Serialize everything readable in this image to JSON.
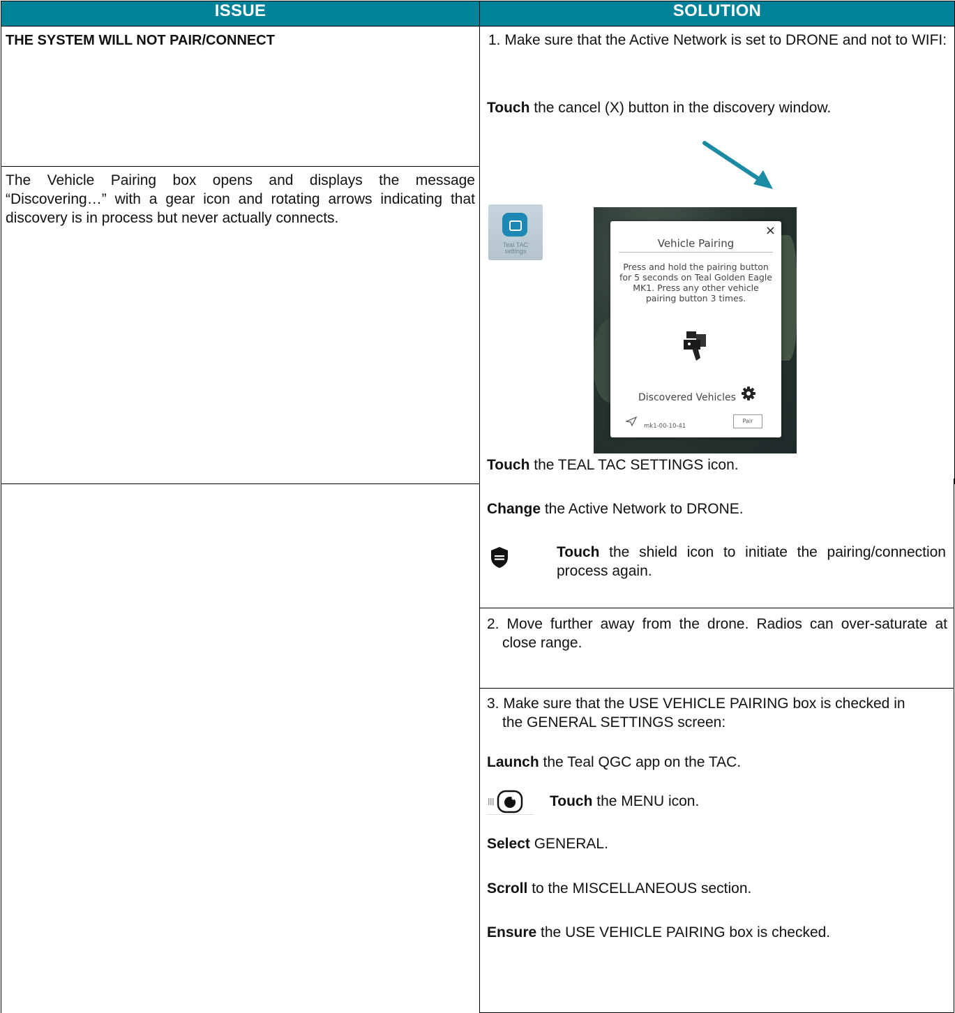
{
  "headers": {
    "issue": "ISSUE",
    "solution": "SOLUTION"
  },
  "issue": {
    "title": "THE SYSTEM WILL NOT PAIR/CONNECT",
    "description": "The Vehicle Pairing box opens and displays the message “Discovering…” with a gear icon and rotating arrows indicating that discovery is in process but never actually connects."
  },
  "solution1": {
    "item": "1. Make sure that the Active Network is set to DRONE and not to WIFI:",
    "cancel": {
      "bold": "Touch",
      "rest": " the cancel (X) button in the discovery window."
    },
    "teal_tac": {
      "bold": "Touch",
      "rest": " the TEAL TAC SETTINGS icon."
    },
    "change": {
      "bold": "Change",
      "rest": " the Active Network to DRONE."
    },
    "shield": {
      "bold": "Touch",
      "rest": " the shield icon to initiate the pairing/connection process again."
    }
  },
  "app_icon_caption": "Teal TAC settings",
  "pairing_dialog": {
    "close": "×",
    "title": "Vehicle Pairing",
    "instructions": "Press and hold the pairing button for 5 seconds on Teal Golden Eagle MK1. Press any other vehicle pairing button 3 times.",
    "discovered": "Discovered Vehicles",
    "vehicle_name": "mk1-00-10-41",
    "pair_button": "Pair"
  },
  "solution2": {
    "item": "2. Move further away from the drone. Radios can over-saturate at close range."
  },
  "solution3": {
    "item": "3. Make sure that the USE VEHICLE PAIRING box is checked in the GENERAL SETTINGS screen:",
    "launch": {
      "bold": "Launch",
      "rest": " the Teal QGC app on the TAC."
    },
    "menu": {
      "bold": "Touch",
      "rest": " the MENU icon."
    },
    "select": {
      "bold": "Select",
      "rest": " GENERAL."
    },
    "scroll": {
      "bold": "Scroll",
      "rest": " to the MISCELLANEOUS section."
    },
    "ensure": {
      "bold": "Ensure",
      "rest": " the USE VEHICLE PAIRING box is checked."
    }
  },
  "colors": {
    "header_bg": "#008299",
    "header_text": "#ffffff",
    "arrow": "#1b8aa3"
  },
  "icons": [
    "teal-tac-settings-icon",
    "close-icon",
    "drone-icon",
    "gear-icon",
    "send-icon",
    "shield-icon",
    "menu-icon",
    "arrow-pointer"
  ]
}
